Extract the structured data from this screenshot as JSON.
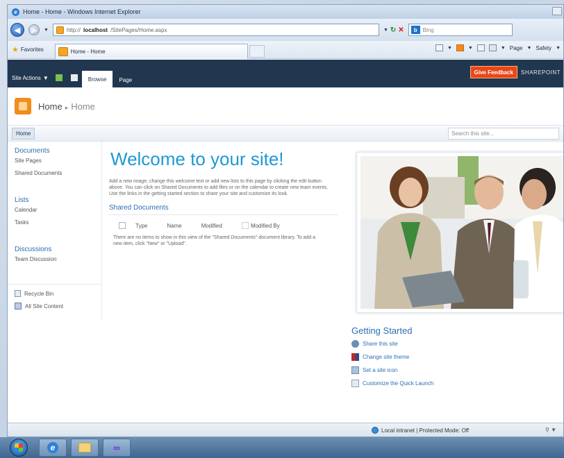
{
  "browser": {
    "window_title": "Home - Home - Windows Internet Explorer",
    "url_prefix": "http://",
    "url_host": "localhost",
    "url_path": "/SitePages/Home.aspx",
    "search_placeholder": "Bing",
    "favorites_label": "Favorites",
    "tab_title": "Home - Home",
    "cmd_page": "Page",
    "cmd_safety": "Safety"
  },
  "ribbon": {
    "site_actions": "Site Actions",
    "tabs": [
      "Browse",
      "Page"
    ],
    "feedback": "Give Feedback",
    "brand": "SHAREPOINT"
  },
  "breadcrumb": {
    "site": "Home",
    "separator": "▸",
    "page": "Home"
  },
  "topnav": {
    "home": "Home",
    "search_placeholder": "Search this site..."
  },
  "quicklaunch": {
    "sections": [
      {
        "heading": "Documents",
        "items": [
          "Site Pages",
          "Shared Documents"
        ]
      },
      {
        "heading": "Lists",
        "items": [
          "Calendar",
          "Tasks"
        ]
      },
      {
        "heading": "Discussions",
        "items": [
          "Team Discussion"
        ]
      }
    ],
    "recycle_bin": "Recycle Bin",
    "all_content": "All Site Content"
  },
  "main": {
    "welcome": "Welcome to your site!",
    "welcome_text": "Add a new image, change this welcome text or add new lists to this page by clicking the edit button above. You can click on Shared Documents to add files or on the calendar to create new team events. Use the links in the getting started section to share your site and customize its look.",
    "shared_title": "Shared Documents",
    "columns": [
      "Type",
      "Name",
      "Modified",
      "Modified By"
    ],
    "empty_text": "There are no items to show in this view of the \"Shared Documents\" document library. To add a new item, click \"New\" or \"Upload\"."
  },
  "getting_started": {
    "title": "Getting Started",
    "links": [
      "Share this site",
      "Change site theme",
      "Set a site icon",
      "Customize the Quick Launch"
    ]
  },
  "status": {
    "zone": "Local intranet | Protected Mode: Off"
  },
  "colors": {
    "ribbon_bg": "#21374f",
    "accent_blue": "#1e98d4",
    "feedback_orange": "#e9471b"
  }
}
